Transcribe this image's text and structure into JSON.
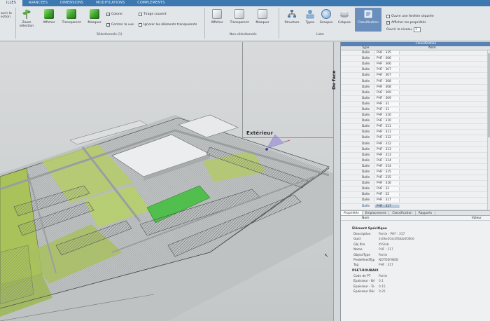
{
  "ribbon": {
    "tabs": [
      "ILLES",
      "AVANCEES",
      "DIMENSIONS",
      "MODIFICATIONS",
      "COMPLEMENTS"
    ],
    "active_tab": "ILLES",
    "left_partial": [
      "avrir la",
      "ection"
    ],
    "buttons": {
      "zoom_selection": "Zoom sélection",
      "afficher": "Afficher",
      "transparent": "Transparent",
      "masquer": "Masquer",
      "afficher2": "Afficher",
      "transparent2": "Transparent",
      "masquer2": "Masquer",
      "structure": "Structure",
      "types": "Types",
      "groupes": "Groupes",
      "calques": "Calques",
      "classification": "Classification"
    },
    "checkboxes": {
      "colorer": "Colorer",
      "tirage_couvert": "Tirage couvert",
      "centrer_vue": "Centrer la vue",
      "ignorer_transparents": "Ignorer les éléments transparents",
      "ouvre_fenetre": "Ouvre une fenêtre séparée",
      "afficher_proprietes": "Afficher les propriétés"
    },
    "checked_mark": "✓",
    "ouvrir_niveau_label": "Ouvrir le niveau",
    "ouvrir_niveau_value": "1",
    "group_labels": {
      "selectionnes": "Sélectionnés (1)",
      "non_selectionnes": "Non sélectionnés",
      "liste": "Liste"
    }
  },
  "viewport": {
    "label": "Extérieur",
    "side_label": "De face"
  },
  "panel": {
    "header_left": "",
    "header_right": "Classification",
    "col_type": "Type",
    "col_name": "Nom",
    "rows": [
      {
        "type": "Dalle",
        "name": "PHF : 335",
        "selected": false
      },
      {
        "type": "Dalle",
        "name": "PHF : 306",
        "selected": false
      },
      {
        "type": "Dalle",
        "name": "PHF : 306",
        "selected": false
      },
      {
        "type": "Dalle",
        "name": "PHF : 307",
        "selected": false
      },
      {
        "type": "Dalle",
        "name": "PHF : 307",
        "selected": false
      },
      {
        "type": "Dalle",
        "name": "PHF : 308",
        "selected": false
      },
      {
        "type": "Dalle",
        "name": "PHF : 308",
        "selected": false
      },
      {
        "type": "Dalle",
        "name": "PHF : 309",
        "selected": false
      },
      {
        "type": "Dalle",
        "name": "PHF : 309",
        "selected": false
      },
      {
        "type": "Dalle",
        "name": "PHF : 31",
        "selected": false
      },
      {
        "type": "Dalle",
        "name": "PHF : 31",
        "selected": false
      },
      {
        "type": "Dalle",
        "name": "PHF : 310",
        "selected": false
      },
      {
        "type": "Dalle",
        "name": "PHF : 310",
        "selected": false
      },
      {
        "type": "Dalle",
        "name": "PHF : 311",
        "selected": false
      },
      {
        "type": "Dalle",
        "name": "PHF : 311",
        "selected": false
      },
      {
        "type": "Dalle",
        "name": "PHF : 312",
        "selected": false
      },
      {
        "type": "Dalle",
        "name": "PHF : 312",
        "selected": false
      },
      {
        "type": "Dalle",
        "name": "PHF : 313",
        "selected": false
      },
      {
        "type": "Dalle",
        "name": "PHF : 313",
        "selected": false
      },
      {
        "type": "Dalle",
        "name": "PHF : 314",
        "selected": false
      },
      {
        "type": "Dalle",
        "name": "PHF : 314",
        "selected": false
      },
      {
        "type": "Dalle",
        "name": "PHF : 315",
        "selected": false
      },
      {
        "type": "Dalle",
        "name": "PHF : 315",
        "selected": false
      },
      {
        "type": "Dalle",
        "name": "PHF : 316",
        "selected": false
      },
      {
        "type": "Dalle",
        "name": "PHF : 32",
        "selected": false
      },
      {
        "type": "Dalle",
        "name": "PHF : 32",
        "selected": false
      },
      {
        "type": "Dalle",
        "name": "PHF : 317",
        "selected": false
      },
      {
        "type": "Dalle",
        "name": "PHF : 317",
        "selected": true
      }
    ],
    "prop_tabs": [
      "Propriétés",
      "Emplacement",
      "Classification",
      "Rapports"
    ],
    "prop_col_name": "Nom",
    "prop_col_value": "Valeur",
    "sections": [
      {
        "title": "Élément Spécifique",
        "items": [
          {
            "k": "Description",
            "v": "Partie : PHF : 317"
          },
          {
            "k": "Guid",
            "v": "2s0ke2Gio1Rbbb0CB0d"
          },
          {
            "k": "Gbj Ifco",
            "v": "IfcSlab"
          },
          {
            "k": "Name",
            "v": "PHF : 317"
          },
          {
            "k": "ObjectType",
            "v": "Partie"
          },
          {
            "k": "PredefinedType",
            "v": "NOTDEFINED"
          },
          {
            "k": "Tag",
            "v": "PHF : 317"
          }
        ]
      },
      {
        "title": "PSET-ROUBAIX",
        "items": [
          {
            "k": "Code de PT",
            "v": "Partie"
          },
          {
            "k": "Épaisseur - Béton coulé sur",
            "v": "0.1"
          },
          {
            "k": "Épaisseur - Tout venant 0/31,5",
            "v": "0.15"
          },
          {
            "k": "Épaisseur Décaissement",
            "v": "0.25"
          }
        ]
      }
    ]
  },
  "colors": {
    "ribbon_tab_bg": "#3d78b0",
    "selection_blue": "#6b8fbd",
    "panel_header": "#5a83b5",
    "model_green": "#a9c25a",
    "highlight_green": "#3fbf3a"
  }
}
